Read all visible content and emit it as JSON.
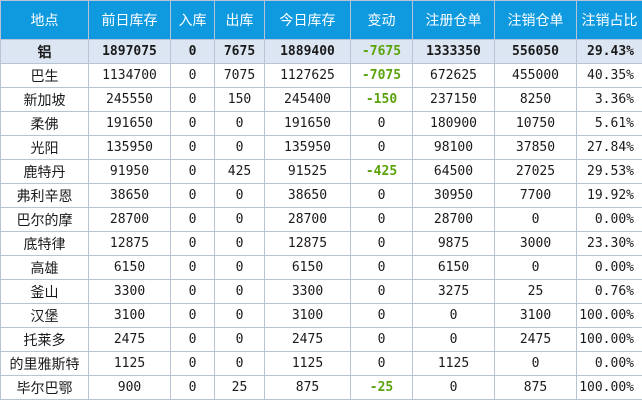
{
  "headers": [
    "地点",
    "前日库存",
    "入库",
    "出库",
    "今日库存",
    "变动",
    "注册仓单",
    "注销仓单",
    "注销占比"
  ],
  "rows": [
    [
      "铝",
      "1897075",
      "0",
      "7675",
      "1889400",
      "-7675",
      "1333350",
      "556050",
      "29.43%"
    ],
    [
      "巴生",
      "1134700",
      "0",
      "7075",
      "1127625",
      "-7075",
      "672625",
      "455000",
      "40.35%"
    ],
    [
      "新加坡",
      "245550",
      "0",
      "150",
      "245400",
      "-150",
      "237150",
      "8250",
      "3.36%"
    ],
    [
      "柔佛",
      "191650",
      "0",
      "0",
      "191650",
      "0",
      "180900",
      "10750",
      "5.61%"
    ],
    [
      "光阳",
      "135950",
      "0",
      "0",
      "135950",
      "0",
      "98100",
      "37850",
      "27.84%"
    ],
    [
      "鹿特丹",
      "91950",
      "0",
      "425",
      "91525",
      "-425",
      "64500",
      "27025",
      "29.53%"
    ],
    [
      "弗利辛恩",
      "38650",
      "0",
      "0",
      "38650",
      "0",
      "30950",
      "7700",
      "19.92%"
    ],
    [
      "巴尔的摩",
      "28700",
      "0",
      "0",
      "28700",
      "0",
      "28700",
      "0",
      "0.00%"
    ],
    [
      "底特律",
      "12875",
      "0",
      "0",
      "12875",
      "0",
      "9875",
      "3000",
      "23.30%"
    ],
    [
      "高雄",
      "6150",
      "0",
      "0",
      "6150",
      "0",
      "6150",
      "0",
      "0.00%"
    ],
    [
      "釜山",
      "3300",
      "0",
      "0",
      "3300",
      "0",
      "3275",
      "25",
      "0.76%"
    ],
    [
      "汉堡",
      "3100",
      "0",
      "0",
      "3100",
      "0",
      "0",
      "3100",
      "100.00%"
    ],
    [
      "托莱多",
      "2475",
      "0",
      "0",
      "2475",
      "0",
      "0",
      "2475",
      "100.00%"
    ],
    [
      "的里雅斯特",
      "1125",
      "0",
      "0",
      "1125",
      "0",
      "1125",
      "0",
      "0.00%"
    ],
    [
      "毕尔巴鄂",
      "900",
      "0",
      "25",
      "875",
      "-25",
      "0",
      "875",
      "100.00%"
    ]
  ],
  "colors": {
    "header_bg": "#0f9ae0",
    "total_row_bg": "#dce6f2",
    "negative": "#5aa30a"
  }
}
